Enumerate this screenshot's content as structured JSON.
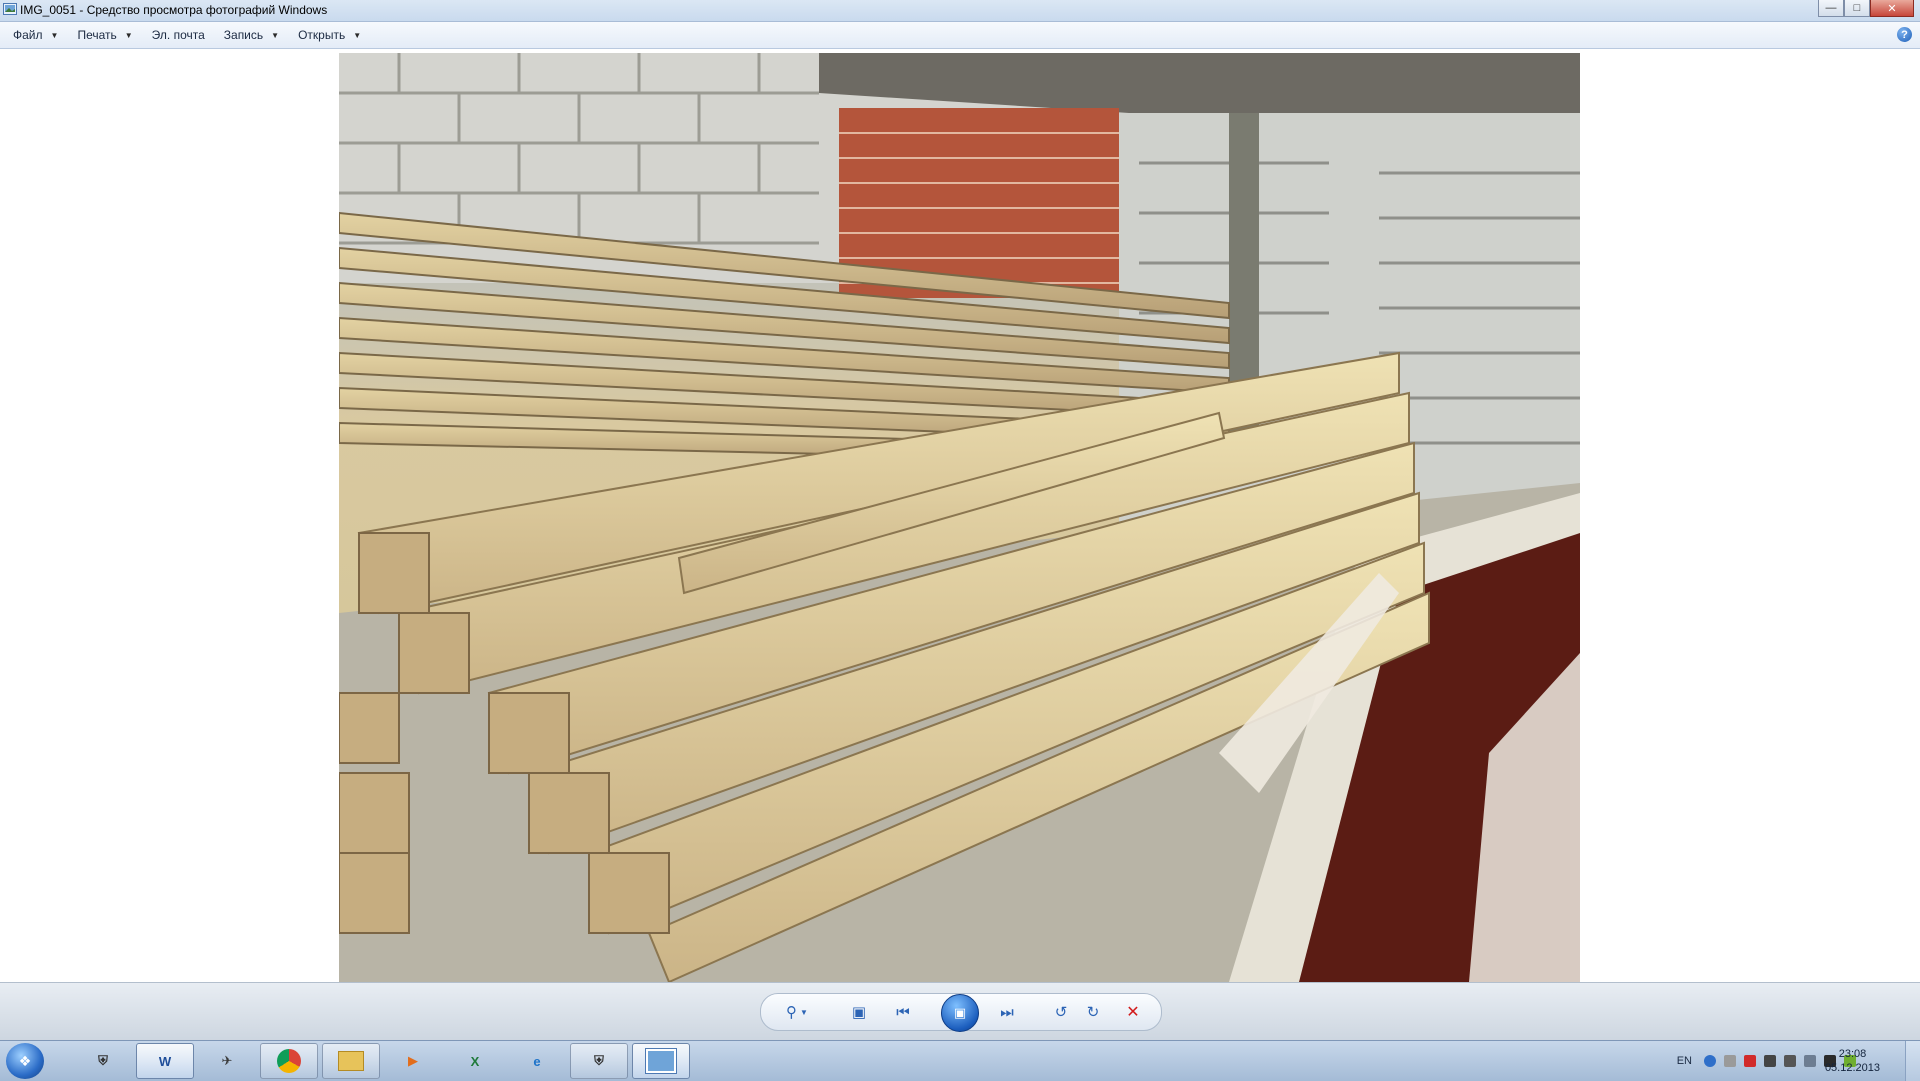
{
  "window": {
    "title": "IMG_0051 - Средство просмотра фотографий Windows",
    "icon": "photo-viewer-icon",
    "controls": [
      "minimize",
      "maximize",
      "close"
    ]
  },
  "menu": {
    "items": [
      {
        "label": "Файл",
        "has_dropdown": true
      },
      {
        "label": "Печать",
        "has_dropdown": true
      },
      {
        "label": "Эл. почта",
        "has_dropdown": false
      },
      {
        "label": "Запись",
        "has_dropdown": true
      },
      {
        "label": "Открыть",
        "has_dropdown": true
      }
    ],
    "help_icon": "help-icon"
  },
  "photo": {
    "subject": "stacked lumber boards beside brick walls",
    "file": "IMG_0051"
  },
  "controlbar": {
    "buttons": [
      "zoom",
      "actual-size",
      "previous",
      "slideshow",
      "next",
      "rotate-counterclockwise",
      "rotate-clockwise",
      "delete"
    ]
  },
  "taskbar": {
    "apps": [
      "start",
      "world-of-tanks",
      "word",
      "world-of-warplanes",
      "chrome",
      "explorer",
      "media-player",
      "excel",
      "internet-explorer",
      "world-of-tanks-2",
      "photo-viewer"
    ],
    "tray": {
      "language": "EN",
      "time": "23:08",
      "date": "05.12.2013"
    }
  },
  "colors": {
    "accent": "#2c64b5",
    "delete": "#d21b1b",
    "titlebar": "#c9daee"
  }
}
